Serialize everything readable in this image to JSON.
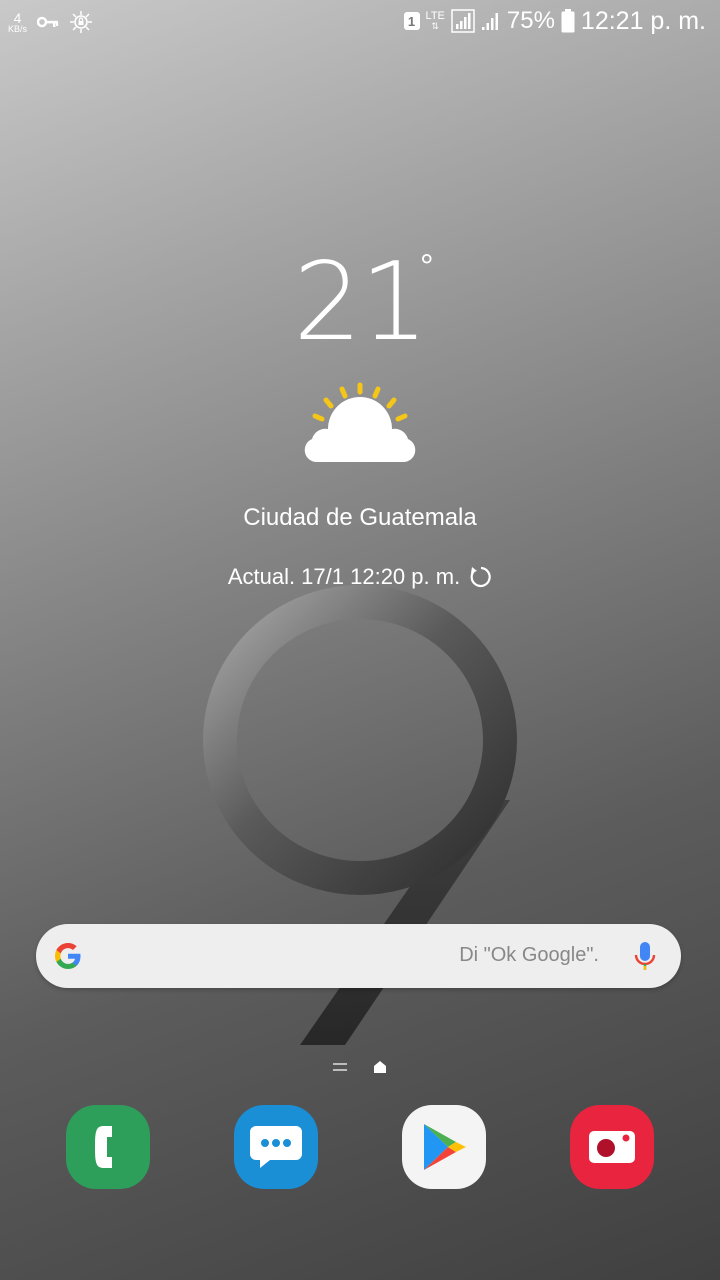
{
  "status_bar": {
    "net_speed_value": "4",
    "net_speed_unit": "KB/s",
    "key_icon": "vpn-key-icon",
    "vpn_icon": "vpn-shield-icon",
    "sim_slot": "1",
    "network_type": "LTE",
    "battery_percent": "75%",
    "time": "12:21 p. m."
  },
  "weather": {
    "temperature": "21",
    "degree_symbol": "°",
    "condition_icon": "partly-sunny-icon",
    "city": "Ciudad de Guatemala",
    "updated_text": "Actual. 17/1 12:20 p. m.",
    "refresh_icon": "refresh-icon"
  },
  "search": {
    "logo": "google-g-icon",
    "hint": "Di \"Ok Google\".",
    "mic_icon": "mic-icon"
  },
  "page_indicator": {
    "pages": [
      "menu-page",
      "home-page"
    ],
    "active": "home-page"
  },
  "dock": {
    "apps": [
      {
        "name": "phone",
        "icon": "phone-icon",
        "color": "#2e9e5b"
      },
      {
        "name": "messages",
        "icon": "messages-icon",
        "color": "#1a8fd6"
      },
      {
        "name": "play-store",
        "icon": "play-store-icon",
        "color": "#f4f4f4"
      },
      {
        "name": "camera",
        "icon": "camera-icon",
        "color": "#e8243f"
      }
    ]
  },
  "colors": {
    "sun_rays": "#f5c518",
    "text_primary": "#ffffff",
    "search_bar_bg": "#eeeeee"
  }
}
